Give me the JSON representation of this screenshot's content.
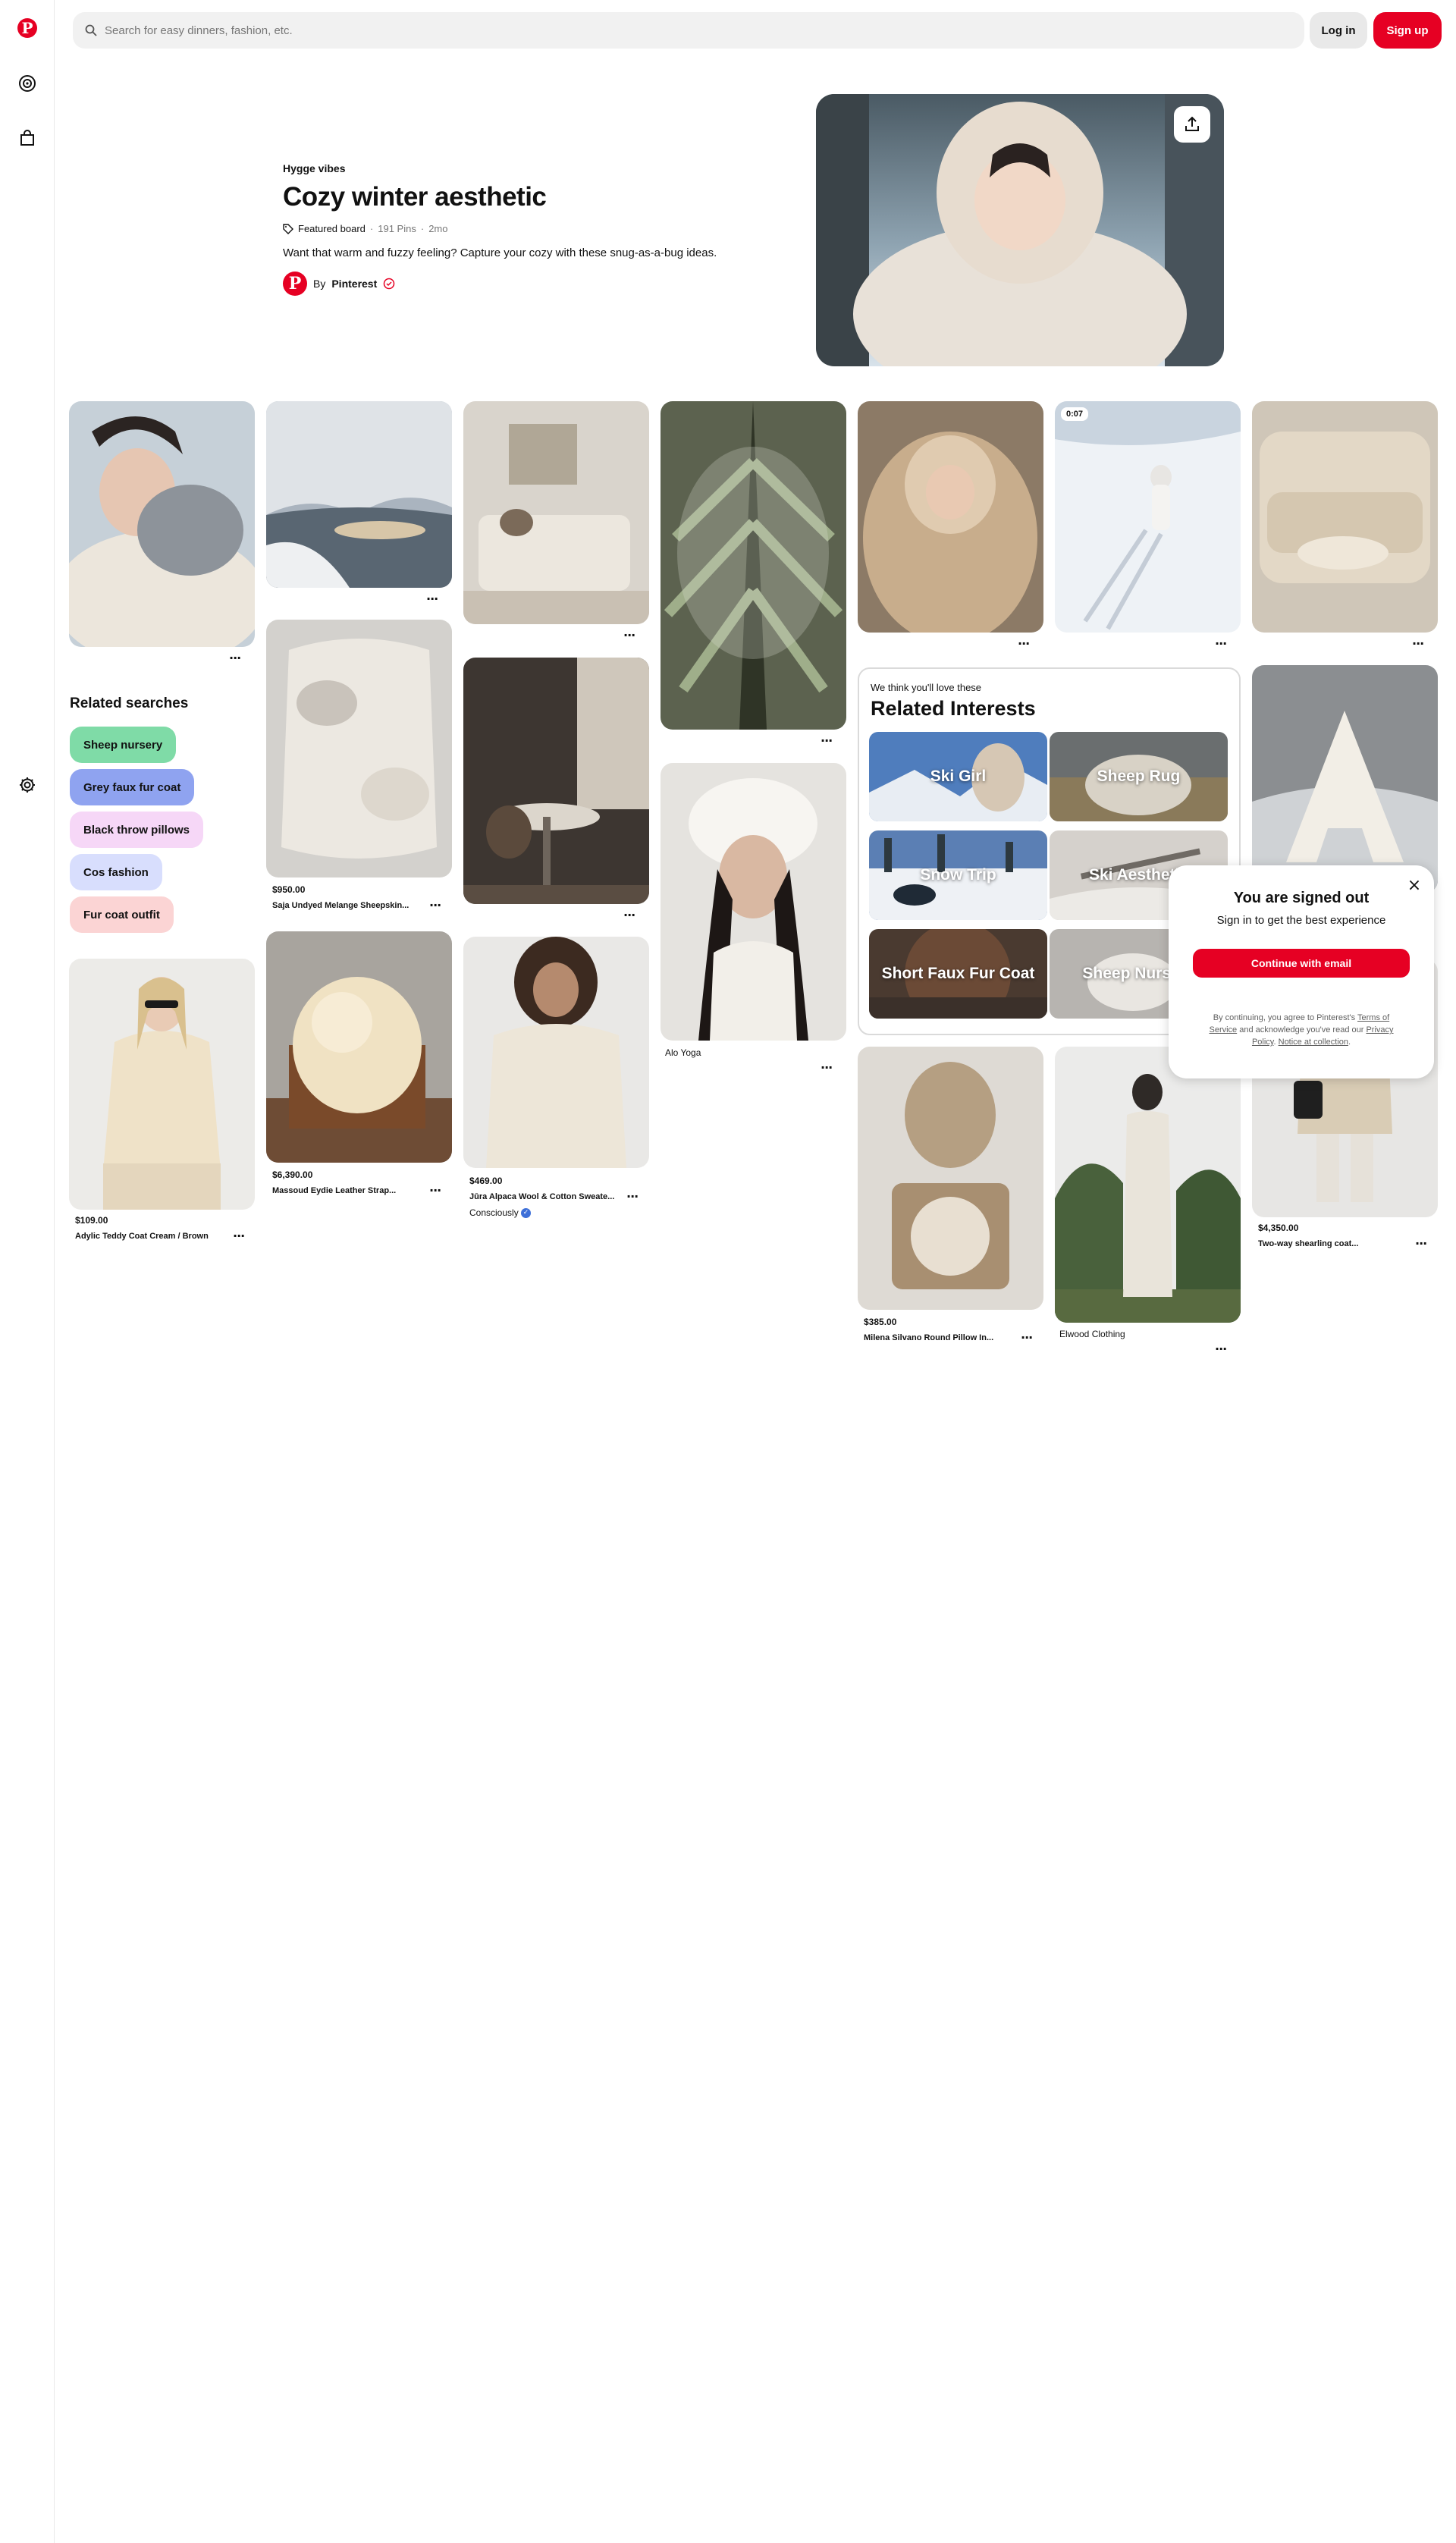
{
  "search": {
    "placeholder": "Search for easy dinners, fashion, etc."
  },
  "header": {
    "login_label": "Log in",
    "signup_label": "Sign up"
  },
  "icons": {
    "logo": "pinterest-logo",
    "explore": "compass-icon",
    "shop": "shopping-bag-icon",
    "settings": "gear-icon",
    "search": "search-icon",
    "share": "share-icon"
  },
  "board": {
    "subtitle": "Hygge vibes",
    "title": "Cozy winter aesthetic",
    "featured_label": "Featured board",
    "pins_count": "191 Pins",
    "age": "2mo",
    "description": "Want that warm and fuzzy feeling? Capture your cozy with these snug-as-a-bug ideas.",
    "by_prefix": "By",
    "author": "Pinterest"
  },
  "related_searches": {
    "title": "Related searches",
    "items": [
      {
        "label": "Sheep nursery",
        "color": "#7fdba7"
      },
      {
        "label": "Grey faux fur coat",
        "color": "#8fa3f0"
      },
      {
        "label": "Black throw pillows",
        "color": "#f6d7f7"
      },
      {
        "label": "Cos fashion",
        "color": "#d8defd"
      },
      {
        "label": "Fur coat outfit",
        "color": "#fbd4d4"
      }
    ]
  },
  "pins": {
    "p_scarf_girl": {
      "more": "···"
    },
    "p_teddy_coat": {
      "price": "$109.00",
      "title": "Adylic Teddy Coat Cream / Brown",
      "more": "···"
    },
    "p_snow_river": {
      "more": "···"
    },
    "p_sheepskin": {
      "price": "$950.00",
      "title": "Saja Undyed Melange Sheepskin...",
      "more": "···"
    },
    "p_fur_chair": {
      "price": "$6,390.00",
      "title": "Massoud Eydie Leather Strap...",
      "more": "···"
    },
    "p_sofa_room": {
      "more": "···"
    },
    "p_dining": {
      "more": "···"
    },
    "p_sweater": {
      "price": "$469.00",
      "title": "Jūra Alpaca Wool & Cotton Sweate...",
      "more": "···",
      "brand": "Consciously"
    },
    "p_pine": {
      "more": "···"
    },
    "p_white_hat": {
      "brand": "Alo Yoga",
      "more": "···"
    },
    "p_fur_hood": {
      "more": "···"
    },
    "p_ski_walk": {
      "more": "···",
      "duration": "0:07"
    },
    "p_pillow_stack": {
      "price": "$385.00",
      "title": "Milena Silvano Round Pillow In...",
      "more": "···"
    },
    "p_elwood": {
      "brand": "Elwood Clothing",
      "more": "···"
    },
    "p_cream_sofa": {
      "more": "···"
    },
    "p_a_pillow": {
      "more": "···"
    },
    "p_shearling": {
      "price": "$4,350.00",
      "title": "Two-way shearling coat...",
      "more": "···"
    }
  },
  "related_interests": {
    "subtitle": "We think you'll love these",
    "title": "Related Interests",
    "tiles": [
      {
        "label": "Ski Girl"
      },
      {
        "label": "Sheep Rug"
      },
      {
        "label": "Snow Trip"
      },
      {
        "label": "Ski Aesthetic"
      },
      {
        "label": "Short Faux Fur Coat"
      },
      {
        "label": "Sheep Nursery"
      }
    ]
  },
  "modal": {
    "title": "You are signed out",
    "subtitle": "Sign in to get the best experience",
    "cta": "Continue with email",
    "legal_1": "By continuing, you agree to Pinterest's ",
    "terms": "Terms of Service",
    "legal_2": " and acknowledge you've read our ",
    "privacy": "Privacy Policy",
    "legal_3": ". ",
    "notice": "Notice at collection",
    "legal_4": ".",
    "close": "×"
  },
  "colors": {
    "brand": "#e60023",
    "chip_bg": "#e9e9e9",
    "search_bg": "#f1f1f1"
  }
}
